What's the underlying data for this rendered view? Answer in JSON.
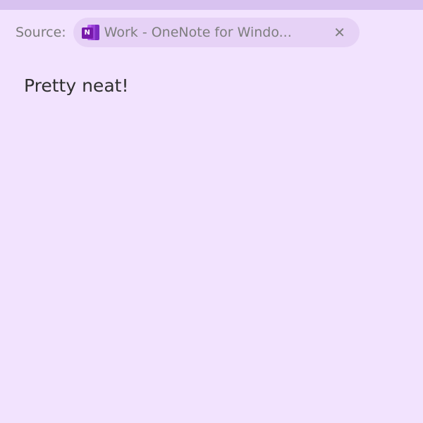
{
  "source": {
    "label": "Source:",
    "app_icon": "onenote-icon",
    "icon_badge": "N",
    "title": "Work - OneNote for Windo...",
    "close_icon": "close-icon",
    "close_glyph": "✕"
  },
  "note": {
    "text": "Pretty neat!"
  },
  "colors": {
    "background": "#f2e3fe",
    "top_bar": "#d8c2f0",
    "chip_background": "#e6d2f6",
    "onenote_purple": "#7719aa"
  }
}
